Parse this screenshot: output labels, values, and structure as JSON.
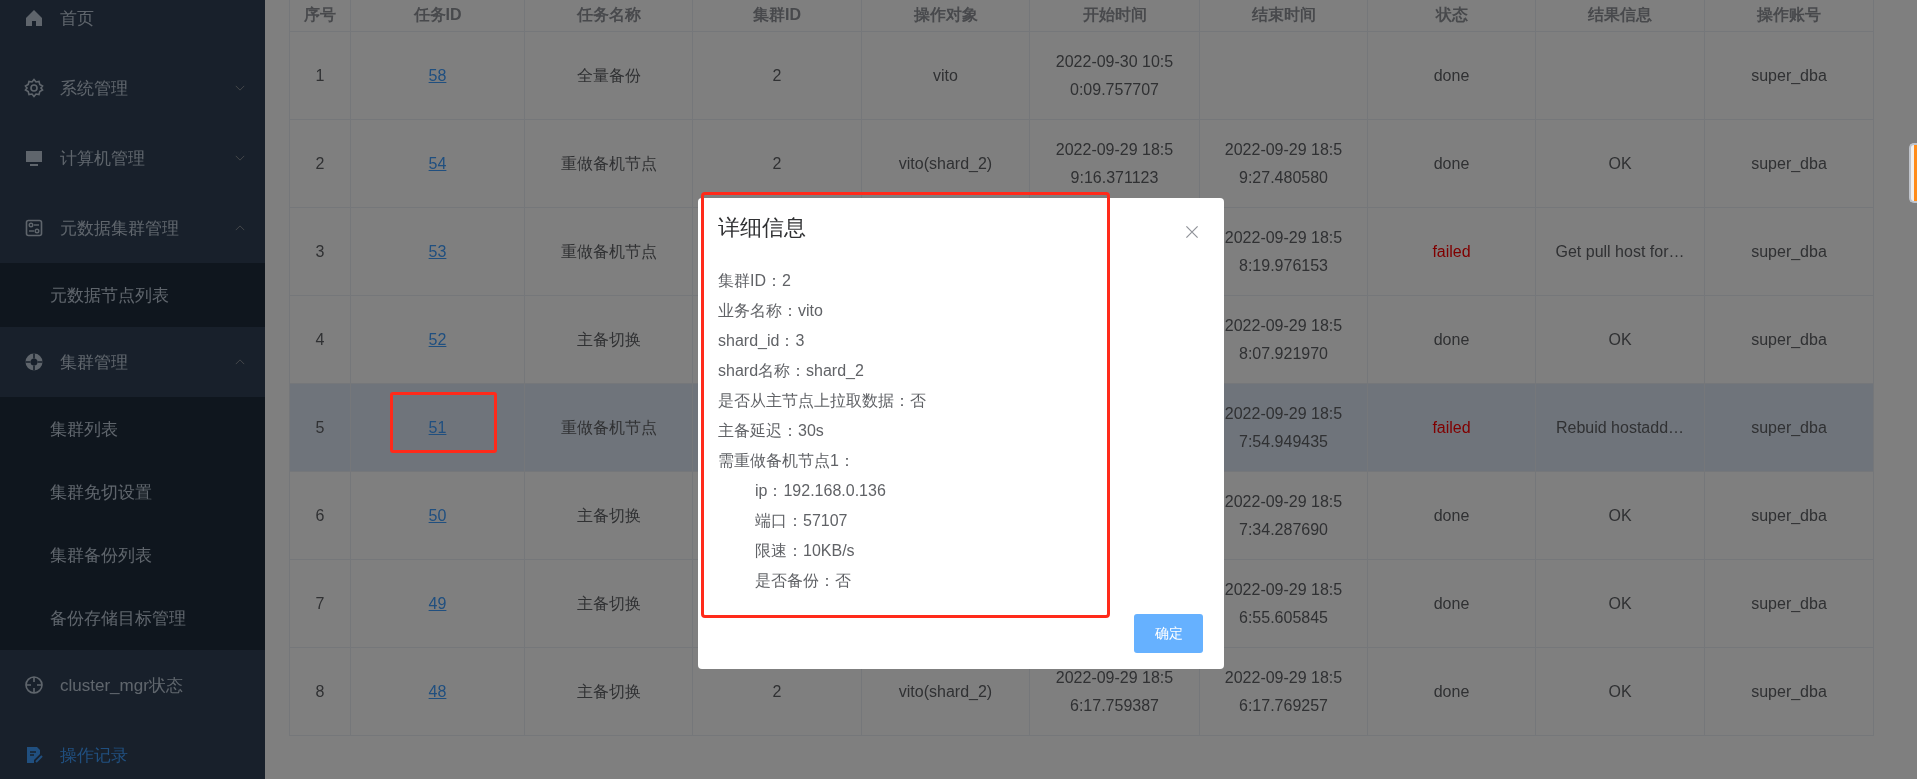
{
  "sidebar": {
    "items": [
      {
        "label": "首页",
        "selected": false
      },
      {
        "label": "系统管理",
        "selected": false,
        "expanded": false
      },
      {
        "label": "计算机管理",
        "selected": false,
        "expanded": false
      },
      {
        "label": "元数据集群管理",
        "selected": false,
        "expanded": true,
        "children": [
          {
            "label": "元数据节点列表",
            "selected": false
          }
        ]
      },
      {
        "label": "集群管理",
        "selected": false,
        "expanded": true,
        "children": [
          {
            "label": "集群列表",
            "selected": false
          },
          {
            "label": "集群免切设置",
            "selected": false
          },
          {
            "label": "集群备份列表",
            "selected": false
          },
          {
            "label": "备份存储目标管理",
            "selected": false
          }
        ]
      },
      {
        "label": "cluster_mgr状态",
        "selected": false
      },
      {
        "label": "操作记录",
        "selected": true
      }
    ]
  },
  "table": {
    "columns": [
      "序号",
      "任务ID",
      "任务名称",
      "集群ID",
      "操作对象",
      "开始时间",
      "结束时间",
      "状态",
      "结果信息",
      "操作账号"
    ],
    "rows": [
      {
        "cells": [
          "1",
          "58",
          "全量备份",
          "2",
          "vito",
          "2022-09-30 10:50:09.757707",
          null,
          "done",
          null,
          "super_dba"
        ],
        "failed": false,
        "selected": false,
        "id_highlighted": false
      },
      {
        "cells": [
          "2",
          "54",
          "重做备机节点",
          "2",
          "vito(shard_2)",
          "2022-09-29 18:59:16.371123",
          "2022-09-29 18:59:27.480580",
          "done",
          "OK",
          "super_dba"
        ],
        "failed": false,
        "selected": false,
        "id_highlighted": false
      },
      {
        "cells": [
          "3",
          "53",
          "重做备机节点",
          null,
          null,
          null,
          "2022-09-29 18:58:19.976153",
          "failed",
          "Get pull host for…",
          "super_dba"
        ],
        "failed": true,
        "selected": false,
        "id_highlighted": false
      },
      {
        "cells": [
          "4",
          "52",
          "主备切换",
          null,
          null,
          null,
          "2022-09-29 18:58:07.921970",
          "done",
          "OK",
          "super_dba"
        ],
        "failed": false,
        "selected": false,
        "id_highlighted": false
      },
      {
        "cells": [
          "5",
          "51",
          "重做备机节点",
          null,
          null,
          null,
          "2022-09-29 18:57:54.949435",
          "failed",
          "Rebuid hostadd…",
          "super_dba"
        ],
        "failed": true,
        "selected": true,
        "id_highlighted": true
      },
      {
        "cells": [
          "6",
          "50",
          "主备切换",
          null,
          null,
          null,
          "2022-09-29 18:57:34.287690",
          "done",
          "OK",
          "super_dba"
        ],
        "failed": false,
        "selected": false,
        "id_highlighted": false
      },
      {
        "cells": [
          "7",
          "49",
          "主备切换",
          null,
          null,
          null,
          "2022-09-29 18:56:55.605845",
          "done",
          "OK",
          "super_dba"
        ],
        "failed": false,
        "selected": false,
        "id_highlighted": false
      },
      {
        "cells": [
          "8",
          "48",
          "主备切换",
          "2",
          "vito(shard_2)",
          "2022-09-29 18:56:17.759387",
          "2022-09-29 18:56:17.769257",
          "done",
          "OK",
          "super_dba"
        ],
        "failed": false,
        "selected": false,
        "id_highlighted": false
      }
    ]
  },
  "dialog": {
    "title": "详细信息",
    "highlighted": true,
    "lines": [
      {
        "text": "集群ID：2"
      },
      {
        "text": "业务名称：vito"
      },
      {
        "text": "shard_id：3"
      },
      {
        "text": "shard名称：shard_2"
      },
      {
        "text": "是否从主节点上拉取数据：否"
      },
      {
        "text": "主备延迟：30s"
      },
      {
        "text": "需重做备机节点1：",
        "children": [
          {
            "text": "ip：192.168.0.136"
          },
          {
            "text": "端口：57107"
          },
          {
            "text": "限速：10KB/s"
          },
          {
            "text": "是否备份：否"
          }
        ]
      }
    ],
    "button": "确定"
  }
}
